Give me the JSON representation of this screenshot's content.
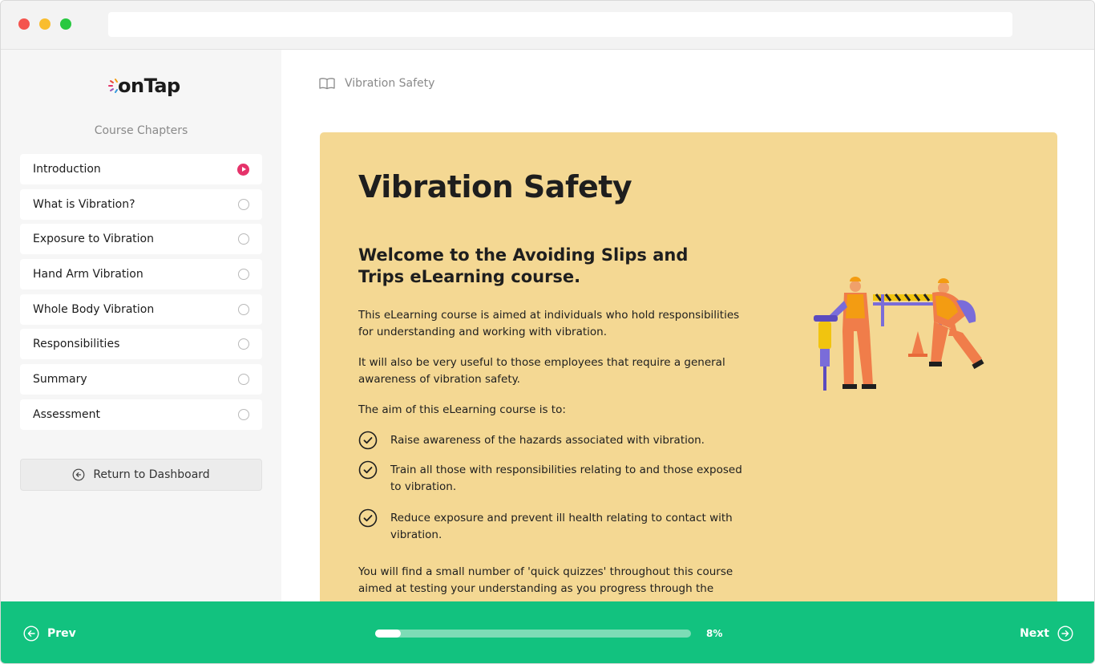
{
  "app": {
    "logo_text": "onTap"
  },
  "sidebar": {
    "heading": "Course Chapters",
    "chapters": [
      {
        "label": "Introduction",
        "status": "current"
      },
      {
        "label": "What is Vibration?",
        "status": "incomplete"
      },
      {
        "label": "Exposure to Vibration",
        "status": "incomplete"
      },
      {
        "label": "Hand Arm Vibration",
        "status": "incomplete"
      },
      {
        "label": "Whole Body Vibration",
        "status": "incomplete"
      },
      {
        "label": "Responsibilities",
        "status": "incomplete"
      },
      {
        "label": "Summary",
        "status": "incomplete"
      },
      {
        "label": "Assessment",
        "status": "incomplete"
      }
    ],
    "return_label": "Return to Dashboard"
  },
  "breadcrumb": {
    "label": "Vibration Safety"
  },
  "content": {
    "title": "Vibration Safety",
    "subtitle": "Welcome to the Avoiding Slips and Trips eLearning course.",
    "para1": "This eLearning course is aimed at individuals who hold responsibilities for understanding and working with vibration.",
    "para2": "It will also be very useful to those employees that require a general awareness of vibration safety.",
    "para3": "The aim of this eLearning course is to:",
    "aims": [
      "Raise awareness of the hazards associated with vibration.",
      "Train all those with responsibilities relating to and those exposed to vibration.",
      "Reduce exposure and prevent ill health relating to contact with vibration."
    ],
    "para4": "You will find a small number of 'quick quizzes' throughout this course aimed at testing your understanding as you progress through the"
  },
  "footer": {
    "prev_label": "Prev",
    "next_label": "Next",
    "progress_percent": 8,
    "progress_text": "8%"
  },
  "colors": {
    "accent_green": "#12c27f",
    "card_yellow": "#f4d893",
    "current_chapter_pink": "#e5336a"
  }
}
